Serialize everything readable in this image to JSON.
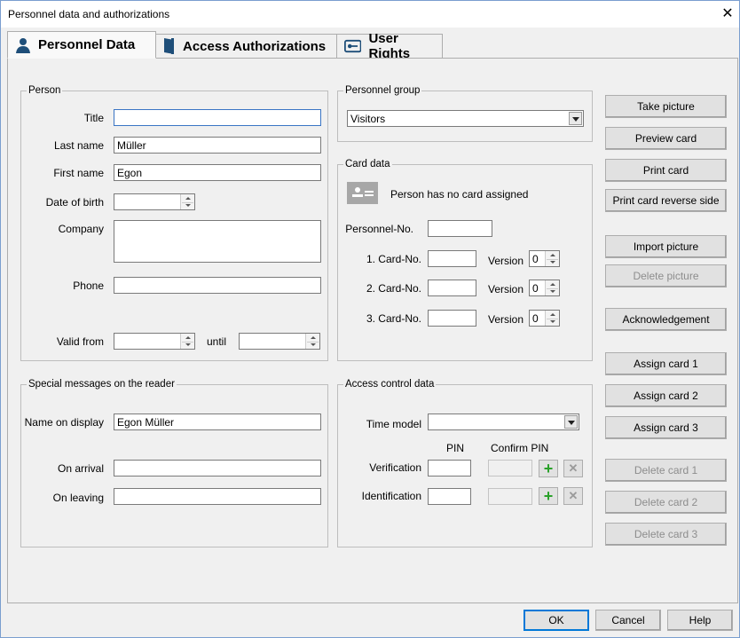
{
  "window": {
    "title": "Personnel data and authorizations",
    "close": "✕"
  },
  "tabs": [
    {
      "label": "Personnel Data",
      "icon": "person-icon",
      "active": true
    },
    {
      "label": "Access Authorizations",
      "icon": "door-icon"
    },
    {
      "label": "User Rights",
      "icon": "key-card-icon"
    }
  ],
  "person": {
    "legend": "Person",
    "title_label": "Title",
    "title_value": "",
    "last_name_label": "Last name",
    "last_name": "Müller",
    "first_name_label": "First name",
    "first_name": "Egon",
    "dob_label": "Date of birth",
    "dob": "",
    "company_label": "Company",
    "company": "",
    "phone_label": "Phone",
    "phone": "",
    "valid_from_label": "Valid from",
    "valid_from": "",
    "until_label": "until",
    "until": ""
  },
  "personnel_group": {
    "legend": "Personnel group",
    "selected": "Visitors"
  },
  "card_data": {
    "legend": "Card data",
    "status": "Person has no card assigned",
    "personnel_no_label": "Personnel-No.",
    "personnel_no": "",
    "cards": [
      {
        "label": "1. Card-No.",
        "value": "",
        "version_label": "Version",
        "version": "0"
      },
      {
        "label": "2. Card-No.",
        "value": "",
        "version_label": "Version",
        "version": "0"
      },
      {
        "label": "3. Card-No.",
        "value": "",
        "version_label": "Version",
        "version": "0"
      }
    ]
  },
  "special": {
    "legend": "Special messages on the reader",
    "name_label": "Name on display",
    "name": "Egon Müller",
    "arrival_label": "On arrival",
    "arrival": "",
    "leaving_label": "On leaving",
    "leaving": ""
  },
  "access": {
    "legend": "Access control data",
    "time_model_label": "Time model",
    "time_model": "",
    "pin_label": "PIN",
    "confirm_pin_label": "Confirm PIN",
    "verification_label": "Verification",
    "identification_label": "Identification",
    "add": "+",
    "remove": "✕"
  },
  "side_buttons": [
    {
      "label": "Take picture",
      "enabled": true
    },
    {
      "label": "Preview card",
      "enabled": true
    },
    {
      "label": "Print card",
      "enabled": true
    },
    {
      "label": "Print card reverse side",
      "enabled": true
    },
    {
      "label": "Import picture",
      "enabled": true
    },
    {
      "label": "Delete picture",
      "enabled": false
    },
    {
      "label": "Acknowledgement",
      "enabled": true
    },
    {
      "label": "Assign card 1",
      "enabled": true
    },
    {
      "label": "Assign card 2",
      "enabled": true
    },
    {
      "label": "Assign card 3",
      "enabled": true
    },
    {
      "label": "Delete card 1",
      "enabled": false
    },
    {
      "label": "Delete card 2",
      "enabled": false
    },
    {
      "label": "Delete card 3",
      "enabled": false
    }
  ],
  "footer": {
    "ok": "OK",
    "cancel": "Cancel",
    "help": "Help"
  },
  "colors": {
    "icon_blue": "#1e4e79",
    "add_green": "#2aa12a"
  }
}
